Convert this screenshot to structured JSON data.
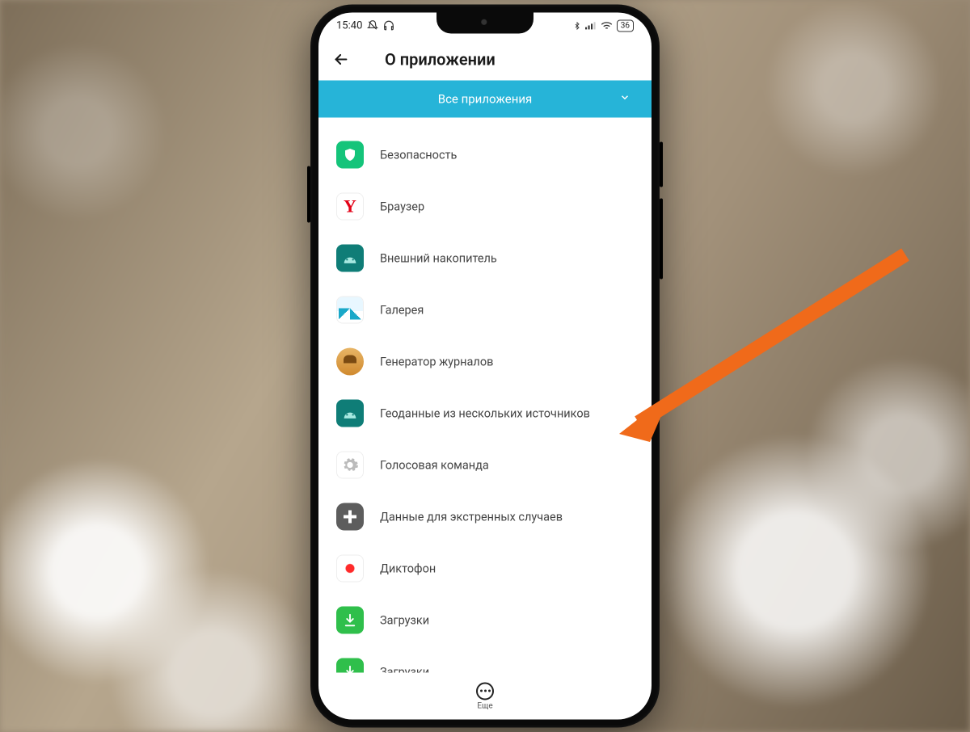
{
  "status": {
    "time": "15:40",
    "battery": "36"
  },
  "header": {
    "title": "О приложении"
  },
  "dropdown": {
    "label": "Все приложения"
  },
  "apps": [
    {
      "label": "Безопасность"
    },
    {
      "label": "Браузер"
    },
    {
      "label": "Внешний накопитель"
    },
    {
      "label": "Галерея"
    },
    {
      "label": "Генератор журналов"
    },
    {
      "label": "Геоданные из нескольких источников"
    },
    {
      "label": "Голосовая команда"
    },
    {
      "label": "Данные для экстренных случаев"
    },
    {
      "label": "Диктофон"
    },
    {
      "label": "Загрузки"
    },
    {
      "label": "Загрузки"
    }
  ],
  "bottom": {
    "more": "Еще"
  },
  "annotation": {
    "arrow_color": "#f06a1a",
    "target_index": 5
  }
}
